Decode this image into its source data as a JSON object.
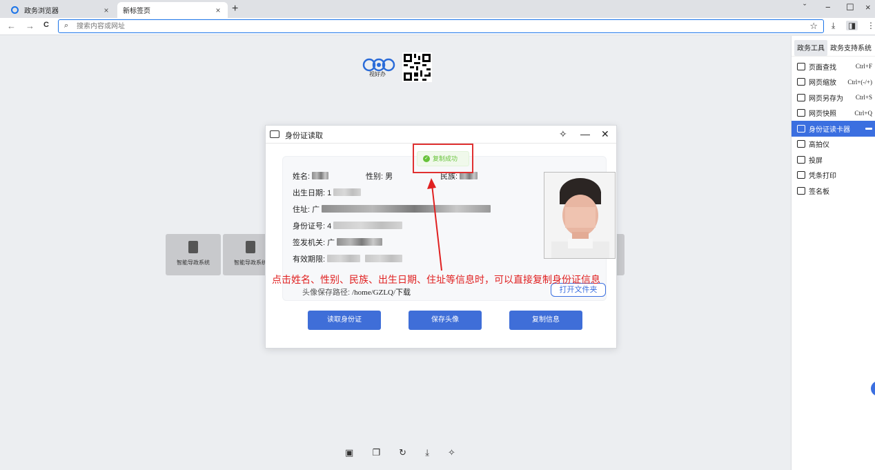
{
  "tabs": [
    {
      "title": "政务浏览器",
      "close": "×"
    },
    {
      "title": "新标签页",
      "close": "×"
    }
  ],
  "new_tab": "+",
  "window_controls": {
    "chevron": "ˇ",
    "minimize": "−",
    "maximize": "☐",
    "close": "×"
  },
  "toolbar": {
    "back": "←",
    "forward": "→",
    "reload": "C",
    "search_icon": "⌕",
    "address_placeholder": "搜索内容或网址",
    "bookmark": "☆",
    "download": "⤓",
    "sidebar_toggle": "◨",
    "menu": "⋮"
  },
  "logo_text": "视好办",
  "tiles": [
    {
      "label": "智能导政系统"
    },
    {
      "label": "智能导政系统"
    }
  ],
  "bottom_icons": [
    "calendar-icon",
    "copy-icon",
    "history-icon",
    "download-icon",
    "extension-icon"
  ],
  "bottom_glyphs": [
    "▣",
    "❐",
    "↻",
    "⤓",
    "✧"
  ],
  "sidebar": {
    "tabs": [
      "政务工具",
      "政务支持系统"
    ],
    "active_tab": 0,
    "items": [
      {
        "label": "页面查找",
        "shortcut": "Ctrl+F"
      },
      {
        "label": "网页缩放",
        "shortcut": "Ctrl+(-/+)"
      },
      {
        "label": "网页另存为",
        "shortcut": "Ctrl+S"
      },
      {
        "label": "网页快照",
        "shortcut": "Ctrl+Q"
      },
      {
        "label": "身份证读卡器",
        "shortcut": ""
      },
      {
        "label": "高拍仪",
        "shortcut": ""
      },
      {
        "label": "投屏",
        "shortcut": ""
      },
      {
        "label": "凭条打印",
        "shortcut": ""
      },
      {
        "label": "签名板",
        "shortcut": ""
      }
    ],
    "active_item": 4
  },
  "dialog": {
    "title": "身份证读取",
    "pin": "✧",
    "minimize": "—",
    "close": "✕",
    "fields": {
      "name_label": "姓名:",
      "gender_label": "性别:",
      "gender_partial": "男",
      "ethnicity_label": "民族:",
      "birth_label": "出生日期:",
      "birth_partial": "1",
      "address_label": "住址:",
      "address_partial": "广",
      "id_label": "身份证号:",
      "id_partial": "4",
      "authority_label": "签发机关:",
      "authority_partial": "广",
      "validity_label": "有效期限:"
    },
    "save_path_label": "头像保存路径:",
    "save_path_value": "/home/GZLQ/下载",
    "open_folder": "打开文件夹",
    "buttons": {
      "read": "读取身份证",
      "save_avatar": "保存头像",
      "copy_info": "复制信息"
    }
  },
  "toast": {
    "text": "复制成功",
    "icon": "✓"
  },
  "annotation": "点击姓名、性别、民族、出生日期、住址等信息时，可以直接复制身份证信息",
  "colors": {
    "accent": "#3f6ed8",
    "annotation": "#e02020",
    "success": "#67c23a"
  }
}
